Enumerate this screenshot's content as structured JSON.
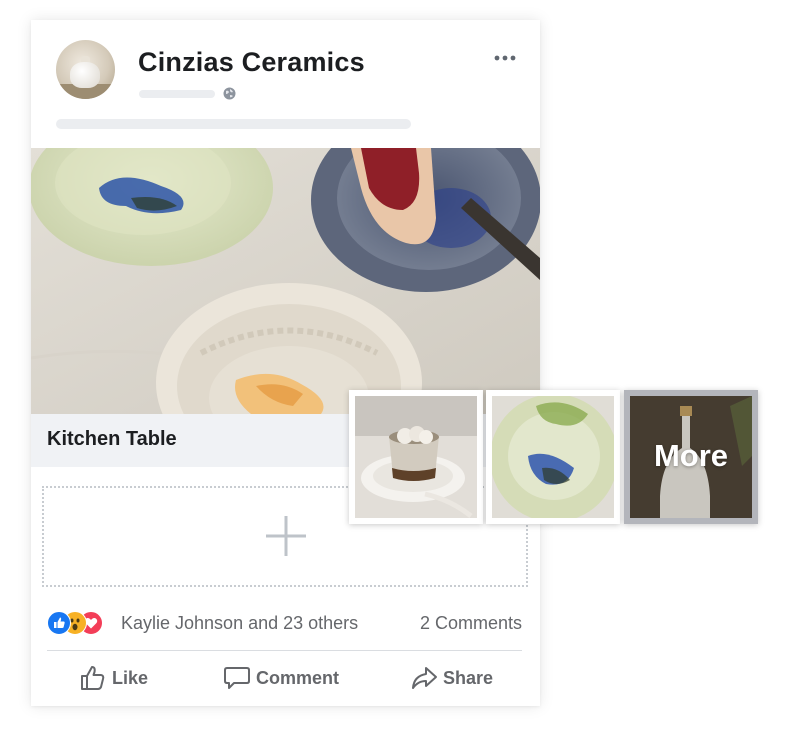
{
  "post": {
    "page_name": "Cinzias Ceramics",
    "photo_caption": "Kitchen Table"
  },
  "engagement": {
    "reactions": [
      "like-reaction-icon",
      "wow-reaction-icon",
      "love-reaction-icon"
    ],
    "reactors_text": "Kaylie Johnson and 23 others",
    "comments_text": "2 Comments"
  },
  "actions": {
    "like_label": "Like",
    "comment_label": "Comment",
    "share_label": "Share"
  },
  "gallery": {
    "more_label": "More"
  },
  "colors": {
    "like_blue": "#1877f2",
    "wow_yellow": "#f7b125",
    "love_red": "#f33e58",
    "text_grey": "#65676b",
    "placeholder_grey": "#ebedf0"
  }
}
